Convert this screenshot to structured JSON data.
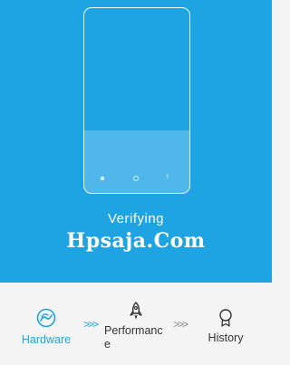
{
  "verify": {
    "status_text": "Verifying",
    "watermark_text": "Hpsaja.Com"
  },
  "steps": [
    {
      "label": "Hardware",
      "icon": "hardware-icon",
      "state": "active"
    },
    {
      "label": "Performance",
      "icon": "rocket-icon",
      "state": "pending"
    },
    {
      "label": "History",
      "icon": "medal-icon",
      "state": "pending"
    }
  ],
  "separators": [
    ">>>",
    ">>>"
  ],
  "colors": {
    "accent": "#1ea3e3",
    "panel_background": "#f4f4f4",
    "text": "#333333"
  }
}
